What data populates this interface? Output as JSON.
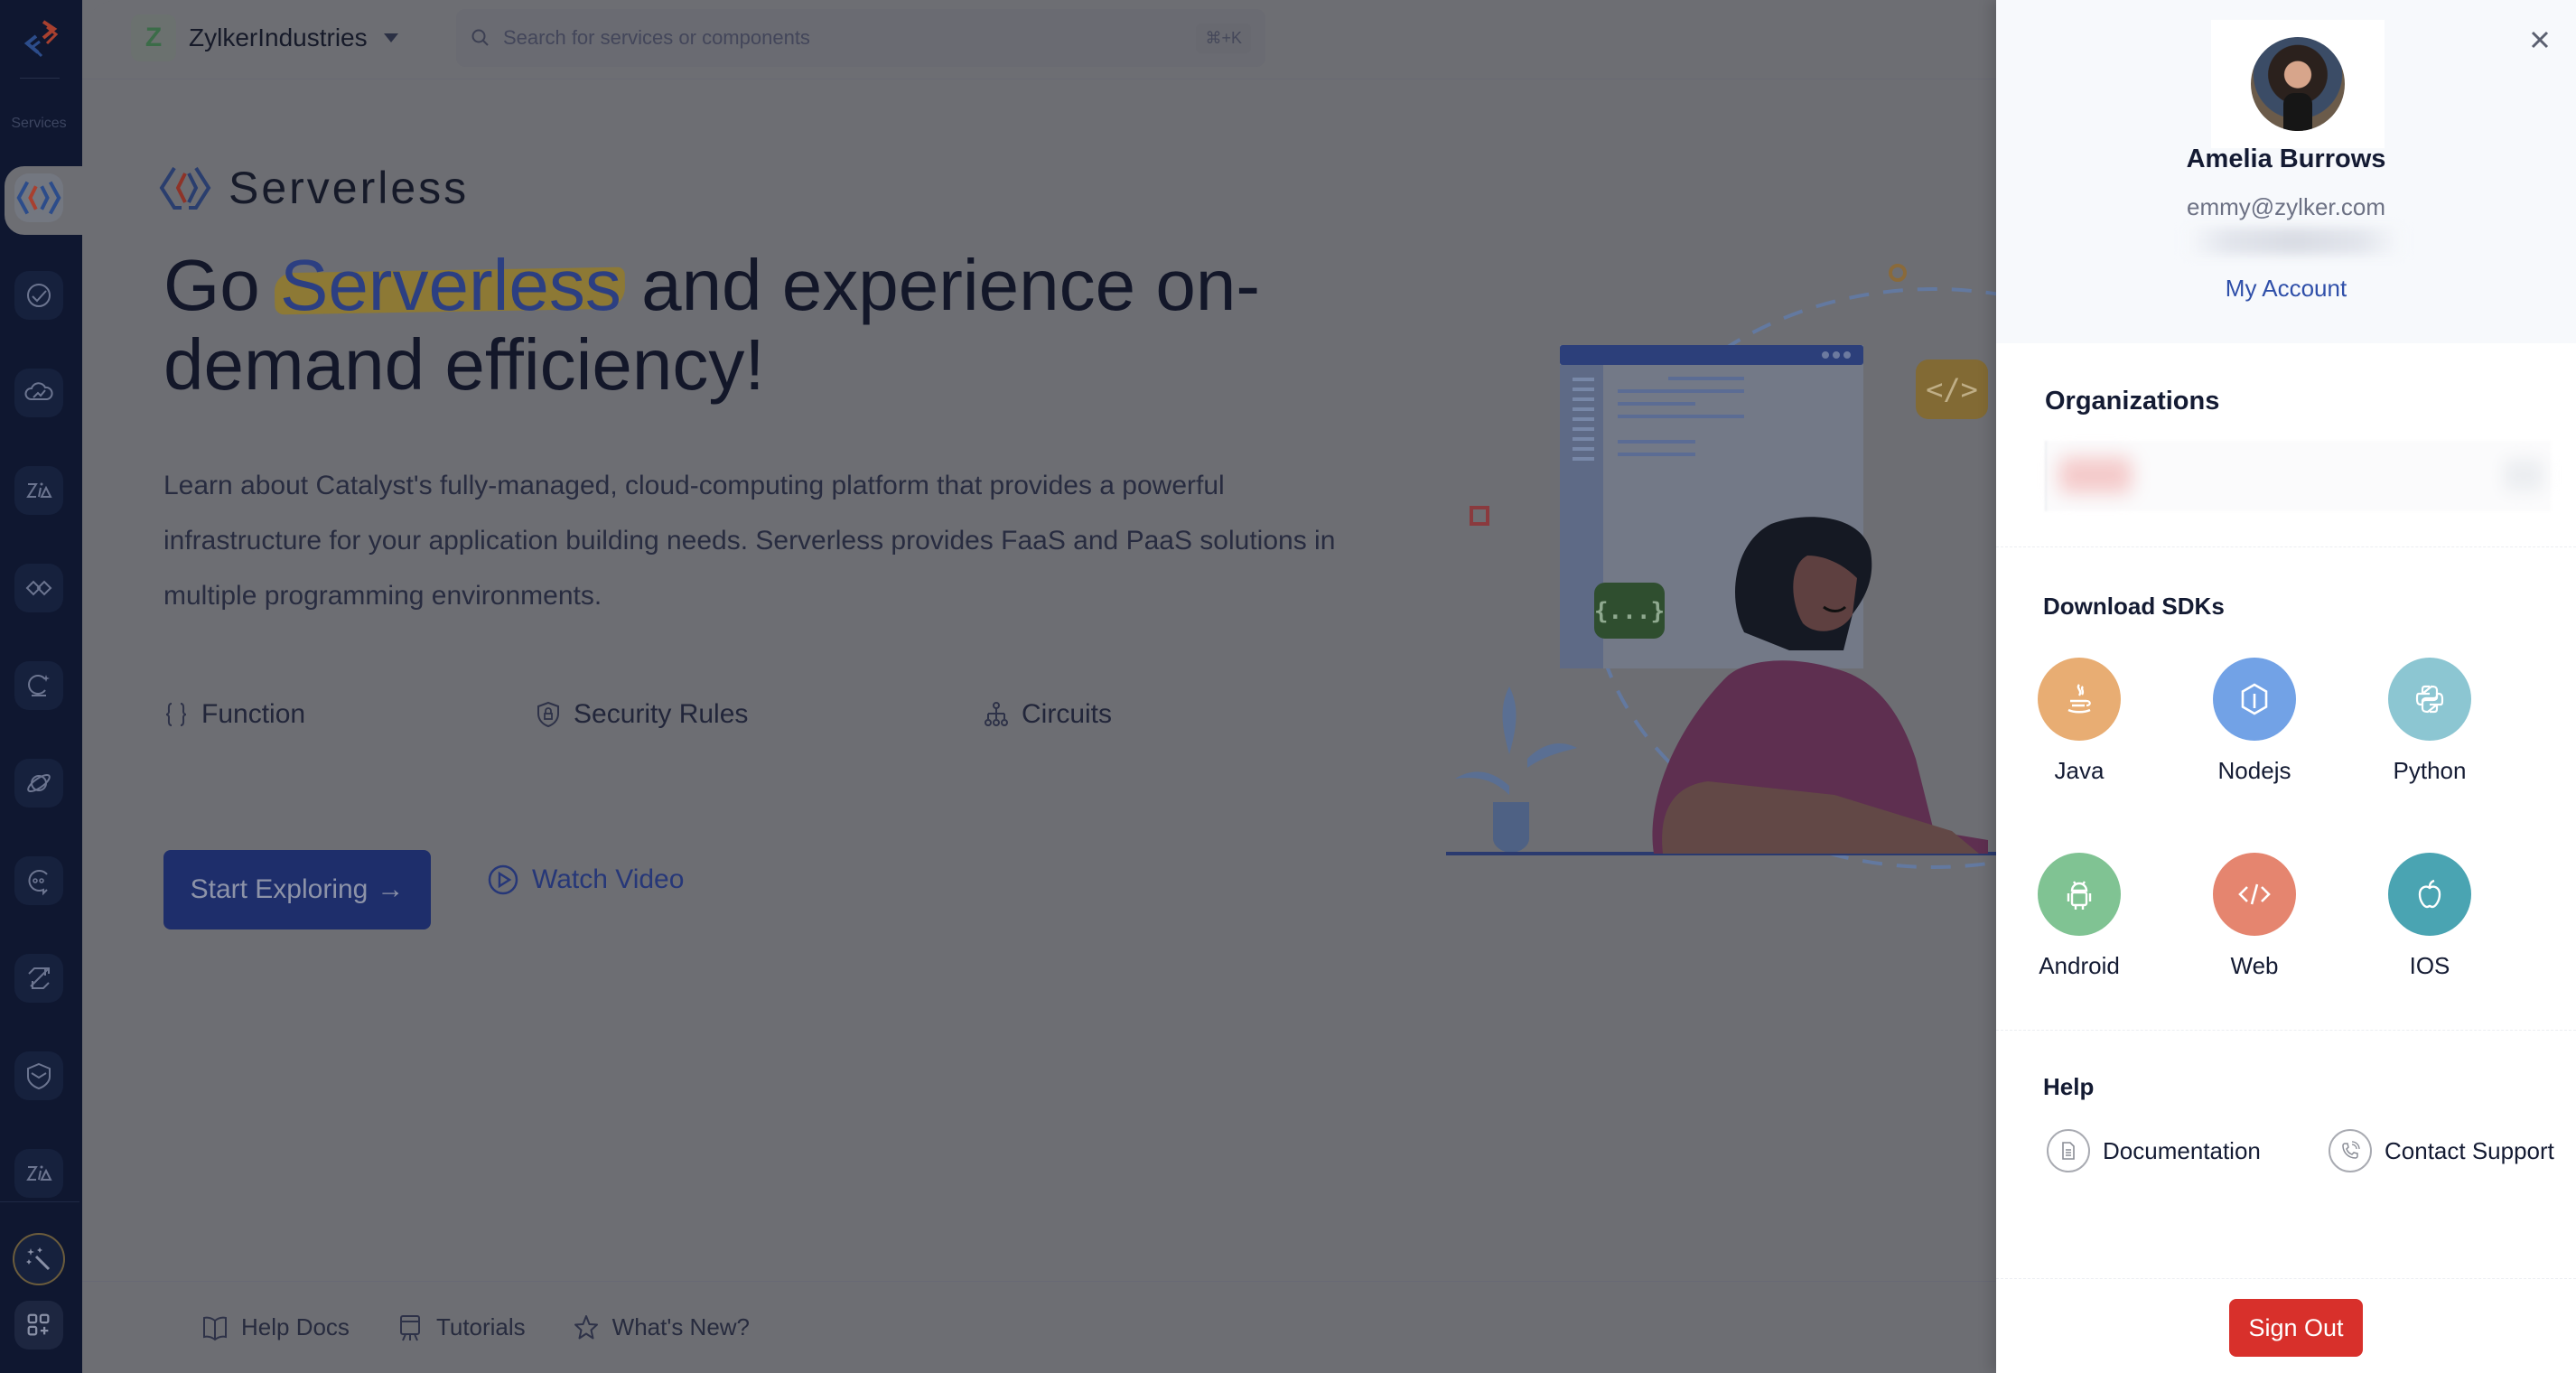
{
  "sidebar": {
    "section_label": "Services",
    "items": [
      {
        "name": "serverless",
        "active": true
      },
      {
        "name": "cloudscale"
      },
      {
        "name": "devops"
      },
      {
        "name": "zia"
      },
      {
        "name": "integrations"
      },
      {
        "name": "quickml"
      },
      {
        "name": "jobs"
      },
      {
        "name": "signals"
      },
      {
        "name": "pipelines"
      },
      {
        "name": "security"
      },
      {
        "name": "zia-services"
      }
    ]
  },
  "topbar": {
    "org_initial": "Z",
    "org_name": "ZylkerIndustries",
    "search_placeholder": "Search for services or components",
    "search_value": "",
    "search_shortcut": "⌘+K"
  },
  "main": {
    "product_name": "Serverless",
    "headline_prefix": "Go ",
    "headline_highlight": "Serverless",
    "headline_suffix": " and experience on-demand efficiency!",
    "description": "Learn about Catalyst's fully-managed, cloud-computing platform that provides a powerful infrastructure for your application building needs. Serverless provides FaaS and PaaS solutions in multiple programming environments.",
    "features": [
      {
        "label": "Function",
        "icon": "braces-icon"
      },
      {
        "label": "Security Rules",
        "icon": "shield-lock-icon"
      },
      {
        "label": "Circuits",
        "icon": "hierarchy-icon"
      }
    ],
    "primary_button": "Start Exploring",
    "primary_button_arrow": "→",
    "secondary_button": "Watch Video",
    "footer_links": [
      {
        "label": "Help Docs",
        "icon": "book-icon"
      },
      {
        "label": "Tutorials",
        "icon": "presentation-icon"
      },
      {
        "label": "What's New?",
        "icon": "star-icon"
      }
    ],
    "illustration": {
      "code_badge": "</>",
      "json_badge": "{...}"
    }
  },
  "profile_panel": {
    "user_name": "Amelia Burrows",
    "user_email": "emmy@zylker.com",
    "my_account": "My Account",
    "organizations_title": "Organizations",
    "download_sdks_title": "Download SDKs",
    "sdks": [
      {
        "label": "Java",
        "color": "#e8ad73",
        "icon": "java-icon"
      },
      {
        "label": "Nodejs",
        "color": "#72a2e6",
        "icon": "nodejs-icon"
      },
      {
        "label": "Python",
        "color": "#8cc6d2",
        "icon": "python-icon"
      },
      {
        "label": "Android",
        "color": "#80c393",
        "icon": "android-icon"
      },
      {
        "label": "Web",
        "color": "#e5856f",
        "icon": "code-icon"
      },
      {
        "label": "IOS",
        "color": "#4aa4b2",
        "icon": "apple-icon"
      }
    ],
    "help_title": "Help",
    "help_links": [
      {
        "label": "Documentation",
        "icon": "document-icon"
      },
      {
        "label": "Contact Support",
        "icon": "phone-icon"
      }
    ],
    "sign_out": "Sign Out"
  },
  "colors": {
    "sidebar_bg": "#0f1730",
    "overlay": "#6d6e73",
    "accent_blue": "#2f4fa9",
    "sign_out_red": "#d8302b",
    "highlight_yellow": "#d9b53a"
  }
}
